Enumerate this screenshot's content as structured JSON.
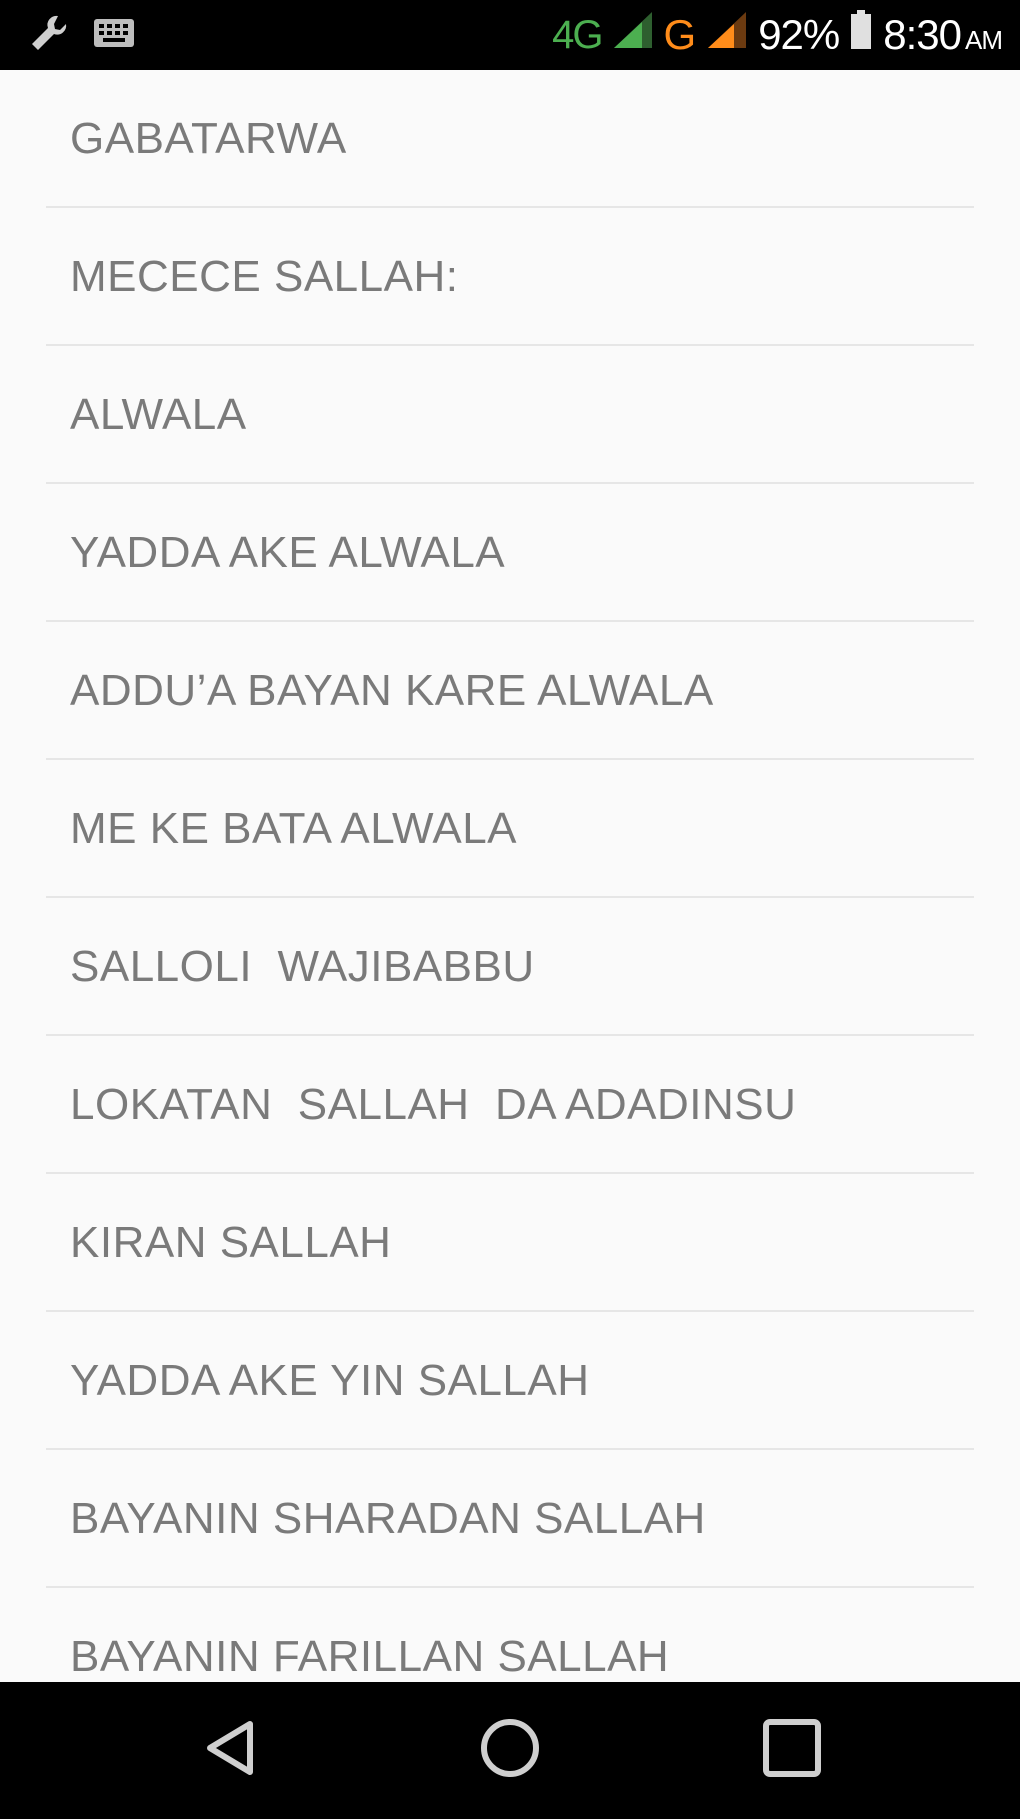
{
  "status_bar": {
    "left_icons": [
      "wrench-icon",
      "keyboard-icon"
    ],
    "network_primary": "4G",
    "network_secondary": "G",
    "battery_percent": "92%",
    "time": "8:30",
    "ampm": "AM",
    "colors": {
      "network_primary": "#4caf50",
      "network_secondary": "#ff8c1a"
    }
  },
  "list": {
    "items": [
      {
        "label": "GABATARWA"
      },
      {
        "label": "MECECE SALLAH:"
      },
      {
        "label": "ALWALA"
      },
      {
        "label": "YADDA AKE ALWALA"
      },
      {
        "label": "ADDU’A BAYAN KARE ALWALA"
      },
      {
        "label": "ME KE BATA ALWALA"
      },
      {
        "label": "SALLOLI  WAJIBABBU"
      },
      {
        "label": "LOKATAN  SALLAH  DA ADADINSU"
      },
      {
        "label": "KIRAN SALLAH"
      },
      {
        "label": "YADDA AKE YIN SALLAH"
      },
      {
        "label": "BAYANIN SHARADAN SALLAH"
      },
      {
        "label": "BAYANIN FARILLAN SALLAH"
      }
    ]
  },
  "nav_bar": {
    "buttons": [
      "back-icon",
      "home-icon",
      "recents-icon"
    ]
  }
}
